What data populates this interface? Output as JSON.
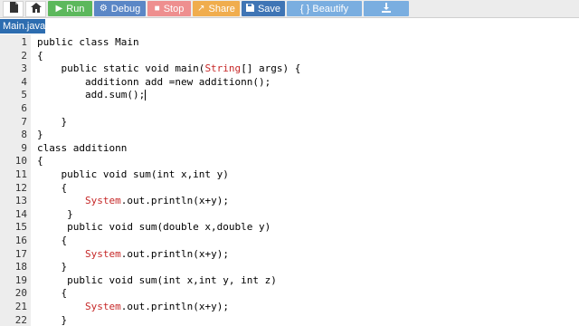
{
  "toolbar": {
    "run_label": "Run",
    "debug_label": "Debug",
    "stop_label": "Stop",
    "share_label": "Share",
    "save_label": "Save",
    "beautify_label": "{ } Beautify",
    "icons": [
      "file-icon",
      "home-icon",
      "play-icon",
      "bug-icon",
      "stop-icon",
      "share-icon",
      "floppy-disk-icon",
      "download-icon"
    ]
  },
  "file_tab": {
    "label": "Main.java"
  },
  "editor": {
    "lines": [
      {
        "num": "1",
        "parts": [
          {
            "t": "public class Main",
            "c": "kw"
          }
        ]
      },
      {
        "num": "2",
        "parts": [
          {
            "t": "{",
            "c": "kw"
          }
        ]
      },
      {
        "num": "3",
        "parts": [
          {
            "t": "    public static void main(",
            "c": "kw"
          },
          {
            "t": "String",
            "c": "ty"
          },
          {
            "t": "[] args) {",
            "c": "kw"
          }
        ]
      },
      {
        "num": "4",
        "parts": [
          {
            "t": "        additionn add =new additionn();",
            "c": "kw"
          }
        ]
      },
      {
        "num": "5",
        "parts": [
          {
            "t": "        add.sum();",
            "c": "kw"
          }
        ],
        "cursor": true
      },
      {
        "num": "6",
        "parts": [
          {
            "t": "",
            "c": "kw"
          }
        ]
      },
      {
        "num": "7",
        "parts": [
          {
            "t": "    }",
            "c": "kw"
          }
        ]
      },
      {
        "num": "8",
        "parts": [
          {
            "t": "}",
            "c": "kw"
          }
        ]
      },
      {
        "num": "9",
        "parts": [
          {
            "t": "class additionn",
            "c": "kw"
          }
        ]
      },
      {
        "num": "10",
        "parts": [
          {
            "t": "{",
            "c": "kw"
          }
        ]
      },
      {
        "num": "11",
        "parts": [
          {
            "t": "    public void sum(int x,int y)",
            "c": "kw"
          }
        ]
      },
      {
        "num": "12",
        "parts": [
          {
            "t": "    {",
            "c": "kw"
          }
        ]
      },
      {
        "num": "13",
        "parts": [
          {
            "t": "        ",
            "c": "kw"
          },
          {
            "t": "System",
            "c": "ty"
          },
          {
            "t": ".out.println(x+y);",
            "c": "kw"
          }
        ]
      },
      {
        "num": "14",
        "parts": [
          {
            "t": "     }",
            "c": "kw"
          }
        ]
      },
      {
        "num": "15",
        "parts": [
          {
            "t": "     public void sum(double x,double y)",
            "c": "kw"
          }
        ]
      },
      {
        "num": "16",
        "parts": [
          {
            "t": "    {",
            "c": "kw"
          }
        ]
      },
      {
        "num": "17",
        "parts": [
          {
            "t": "        ",
            "c": "kw"
          },
          {
            "t": "System",
            "c": "ty"
          },
          {
            "t": ".out.println(x+y);",
            "c": "kw"
          }
        ]
      },
      {
        "num": "18",
        "parts": [
          {
            "t": "    }",
            "c": "kw"
          }
        ]
      },
      {
        "num": "19",
        "parts": [
          {
            "t": "     public void sum(int x,int y, int z)",
            "c": "kw"
          }
        ]
      },
      {
        "num": "20",
        "parts": [
          {
            "t": "    {",
            "c": "kw"
          }
        ]
      },
      {
        "num": "21",
        "parts": [
          {
            "t": "        ",
            "c": "kw"
          },
          {
            "t": "System",
            "c": "ty"
          },
          {
            "t": ".out.println(x+y);",
            "c": "kw"
          }
        ]
      },
      {
        "num": "22",
        "parts": [
          {
            "t": "    }",
            "c": "kw"
          }
        ]
      }
    ]
  }
}
